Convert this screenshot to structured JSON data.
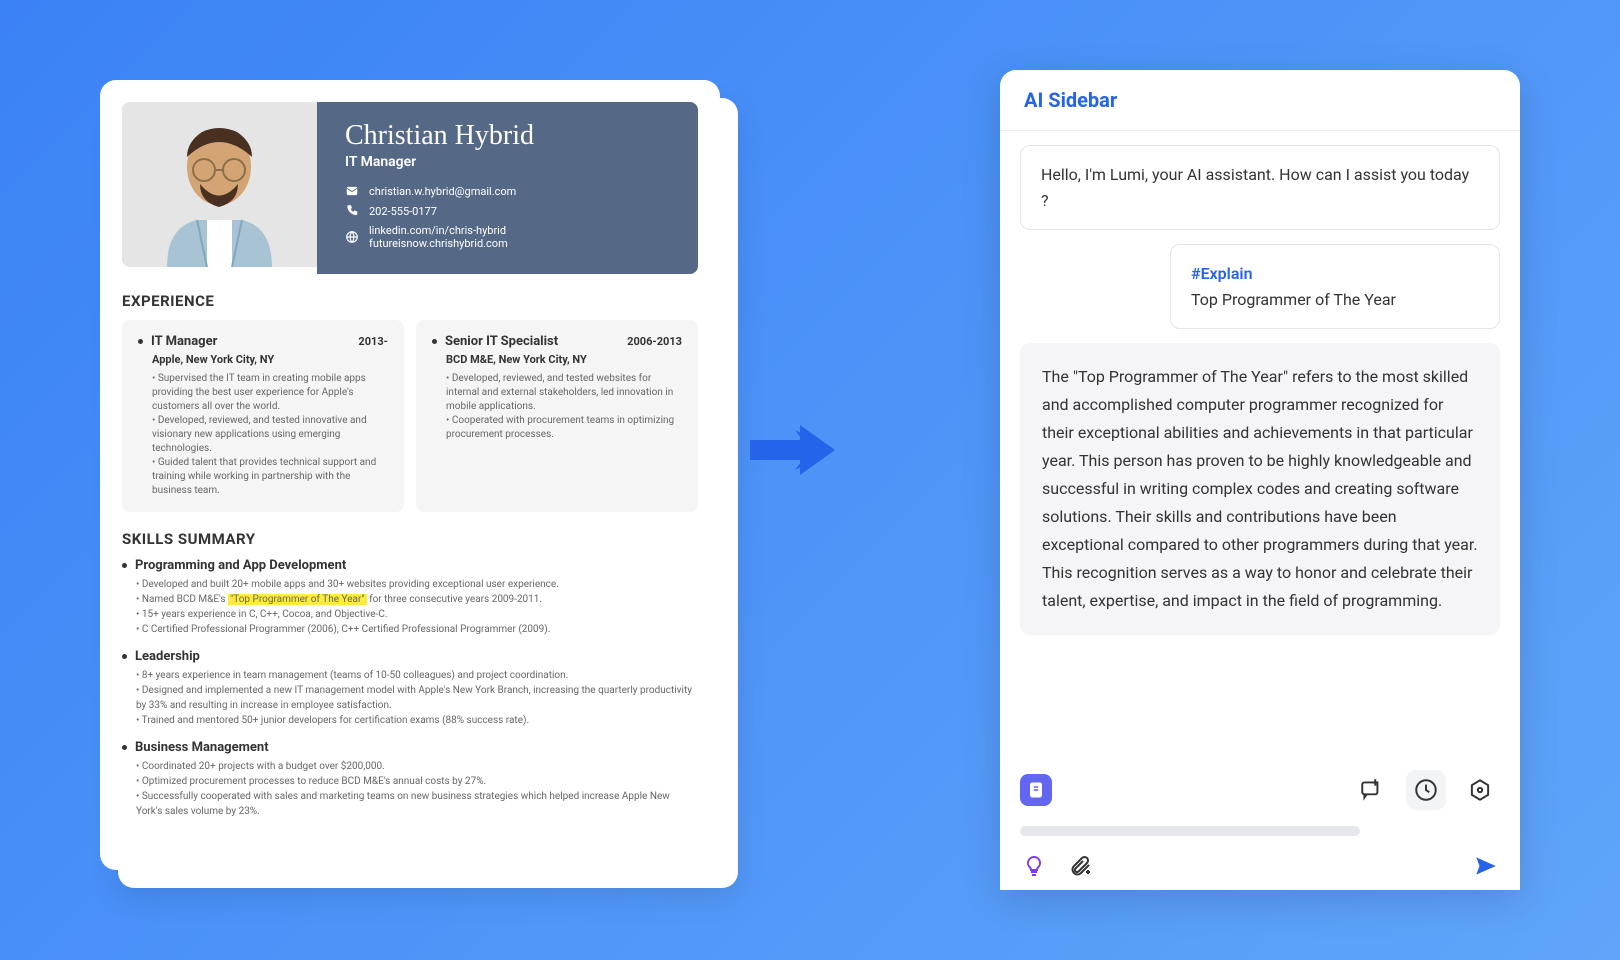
{
  "resume": {
    "name": "Christian Hybrid",
    "title": "IT Manager",
    "email": "christian.w.hybrid@gmail.com",
    "phone": "202-555-0177",
    "linkedin": "linkedin.com/in/chris-hybrid",
    "website": "futureisnow.chrishybrid.com",
    "experience_label": "EXPERIENCE",
    "exp": [
      {
        "role": "IT Manager",
        "date": "2013-",
        "company": "Apple, New York City, NY",
        "points": "• Supervised the IT team in creating mobile apps providing the best user experience for Apple's customers all over the world.\n• Developed, reviewed, and tested innovative and visionary new applications using emerging technologies.\n• Guided talent that provides technical support and training while working in partnership with the business team."
      },
      {
        "role": "Senior IT Specialist",
        "date": "2006-2013",
        "company": "BCD M&E, New York City, NY",
        "points": "• Developed, reviewed, and tested websites for internal and external stakeholders, led innovation in mobile applications.\n• Cooperated with procurement teams in optimizing procurement processes."
      }
    ],
    "skills_label": "SKILLS SUMMARY",
    "skills": [
      {
        "title": "Programming and App Development",
        "line1": "• Developed and built 20+ mobile apps and 30+ websites providing exceptional user experience.",
        "line2_a": "• Named BCD M&E's ",
        "line2_hl": "\"Top Programmer of The Year\"",
        "line2_b": " for three consecutive years 2009-2011.",
        "line3": "• 15+ years experience in C, C++, Cocoa, and Objective-C.",
        "line4": "• C Certified Professional Programmer (2006), C++ Certified Professional Programmer (2009)."
      },
      {
        "title": "Leadership",
        "content": "• 8+ years experience in team management (teams of 10-50 colleagues) and project coordination.\n• Designed and implemented a new IT management model with Apple's New York Branch, increasing the quarterly productivity by 33% and resulting in increase in employee satisfaction.\n• Trained and mentored 50+ junior developers for certification exams (88% success rate)."
      },
      {
        "title": "Business Management",
        "content": "• Coordinated 20+ projects with a budget over $200,000.\n• Optimized procurement processes to reduce BCD M&E's annual costs by 27%.\n• Successfully cooperated with sales and marketing teams on new business strategies which helped increase Apple New York's sales volume by 23%."
      }
    ]
  },
  "sidebar": {
    "title": "AI Sidebar",
    "greeting": "Hello, I'm Lumi, your AI assistant. How can I assist you today ?",
    "user_tag": "#Explain",
    "user_text": "Top Programmer of The Year",
    "response": "The \"Top Programmer of The Year\" refers to the most skilled and accomplished computer programmer recognized for their exceptional abilities and  achievements in that particular year. This person has proven to be highly knowledgeable and successful in writing complex codes and creating software solutions. Their skills and contributions have been exceptional compared to other programmers during that year. This recognition serves as a way to honor and celebrate their talent, expertise, and impact in the field of programming."
  }
}
